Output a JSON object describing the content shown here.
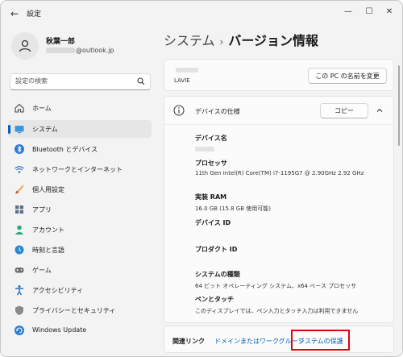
{
  "window": {
    "title": "設定",
    "back_glyph": "←",
    "minimize_glyph": "—",
    "maximize_glyph": "☐",
    "close_glyph": "✕"
  },
  "profile": {
    "name": "秋葉一郎",
    "email_domain": "@outlook.jp"
  },
  "search": {
    "placeholder": "設定の検索"
  },
  "sidebar": {
    "items": [
      {
        "label": "ホーム",
        "icon": "home-icon"
      },
      {
        "label": "システム",
        "icon": "system-icon",
        "active": true
      },
      {
        "label": "Bluetooth とデバイス",
        "icon": "bluetooth-icon"
      },
      {
        "label": "ネットワークとインターネット",
        "icon": "wifi-icon"
      },
      {
        "label": "個人用設定",
        "icon": "brush-icon"
      },
      {
        "label": "アプリ",
        "icon": "apps-icon"
      },
      {
        "label": "アカウント",
        "icon": "account-icon"
      },
      {
        "label": "時刻と言語",
        "icon": "clock-globe-icon"
      },
      {
        "label": "ゲーム",
        "icon": "gamepad-icon"
      },
      {
        "label": "アクセシビリティ",
        "icon": "accessibility-icon"
      },
      {
        "label": "プライバシーとセキュリティ",
        "icon": "shield-icon"
      },
      {
        "label": "Windows Update",
        "icon": "update-icon"
      }
    ],
    "accent_color": "#005fb8"
  },
  "breadcrumb": {
    "parent": "システム",
    "separator": "›",
    "current": "バージョン情報"
  },
  "device_card": {
    "model": "LAVIE",
    "rename_button": "この PC の名前を変更"
  },
  "spec_card": {
    "title": "デバイスの仕様",
    "copy_button": "コピー",
    "rows": [
      {
        "label": "デバイス名",
        "value": ""
      },
      {
        "label": "プロセッサ",
        "value": "11th Gen Intel(R) Core(TM) i7-1195G7 @ 2.90GHz   2.92 GHz"
      },
      {
        "label": "実装 RAM",
        "value": "16.0 GB (15.8 GB 使用可能)"
      },
      {
        "label": "デバイス ID",
        "value": ""
      },
      {
        "label": "プロダクト ID",
        "value": ""
      },
      {
        "label": "システムの種類",
        "value": "64 ビット オペレーティング システム、x64 ベース プロセッサ"
      },
      {
        "label": "ペンとタッチ",
        "value": "このディスプレイでは、ペン入力とタッチ入力は利用できません"
      }
    ]
  },
  "related": {
    "title": "関連リンク",
    "links": [
      "ドメインまたはワークグループ",
      "システムの保護"
    ],
    "highlight_color": "#e3000f"
  }
}
